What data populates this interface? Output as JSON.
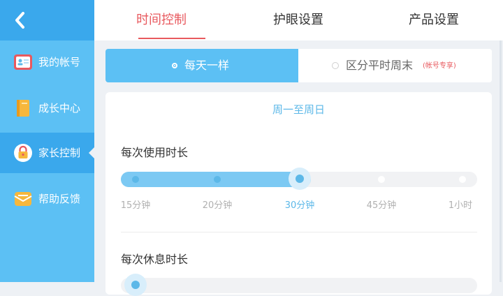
{
  "sidebar": {
    "back_icon": "back-chevron-icon",
    "items": [
      {
        "label": "我的帐号",
        "icon": "account-card-icon",
        "color": "#e8595e"
      },
      {
        "label": "成长中心",
        "icon": "book-icon",
        "color": "#f6b73c"
      },
      {
        "label": "家长控制",
        "icon": "lock-icon",
        "color": "#f6b73c",
        "active": true
      },
      {
        "label": "帮助反馈",
        "icon": "message-icon",
        "color": "#f6b73c"
      }
    ]
  },
  "tabs": [
    {
      "label": "时间控制",
      "active": true
    },
    {
      "label": "护眼设置"
    },
    {
      "label": "产品设置"
    }
  ],
  "mode": {
    "left_label": "每天一样",
    "right_label": "区分平时周末",
    "right_note": "(帐号专享)",
    "selected": "left"
  },
  "card": {
    "heading": "周一至周日",
    "usage": {
      "title": "每次使用时长",
      "options": [
        "15分钟",
        "20分钟",
        "30分钟",
        "45分钟",
        "1小时"
      ],
      "selected_index": 2
    },
    "rest": {
      "title": "每次休息时长",
      "selected_index": 0
    }
  },
  "colors": {
    "accent_blue": "#5cb8e8",
    "sidebar_blue": "#5cc0f4",
    "active_red": "#e8595e"
  }
}
